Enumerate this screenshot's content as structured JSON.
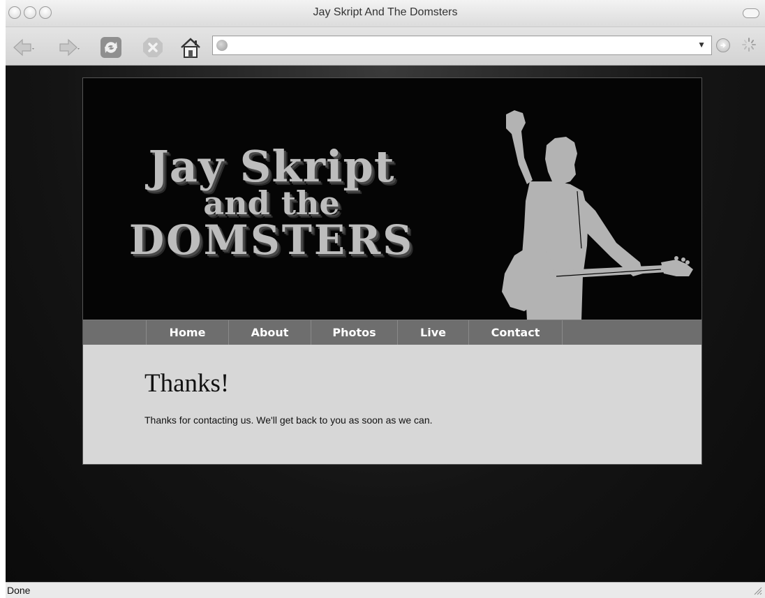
{
  "window": {
    "title": "Jay Skript And The Domsters"
  },
  "toolbar": {
    "back_icon": "back-arrow-icon",
    "forward_icon": "forward-arrow-icon",
    "reload_icon": "reload-icon",
    "stop_icon": "stop-icon",
    "home_icon": "home-icon",
    "url_value": "",
    "go_icon": "go-icon"
  },
  "site": {
    "logo": {
      "line1": "Jay Skript",
      "line2": "and the",
      "line3": "DOMSTERS"
    },
    "nav": [
      {
        "label": "Home"
      },
      {
        "label": "About"
      },
      {
        "label": "Photos"
      },
      {
        "label": "Live"
      },
      {
        "label": "Contact"
      }
    ],
    "heading": "Thanks!",
    "message": "Thanks for contacting us. We'll get back to you as soon as we can."
  },
  "status": {
    "text": "Done"
  },
  "colors": {
    "page_background": "#0b0b0b",
    "header_background": "#050505",
    "nav_background": "#6e6e6e",
    "content_background": "#d7d7d7",
    "logo_color": "#bdbdbd"
  }
}
